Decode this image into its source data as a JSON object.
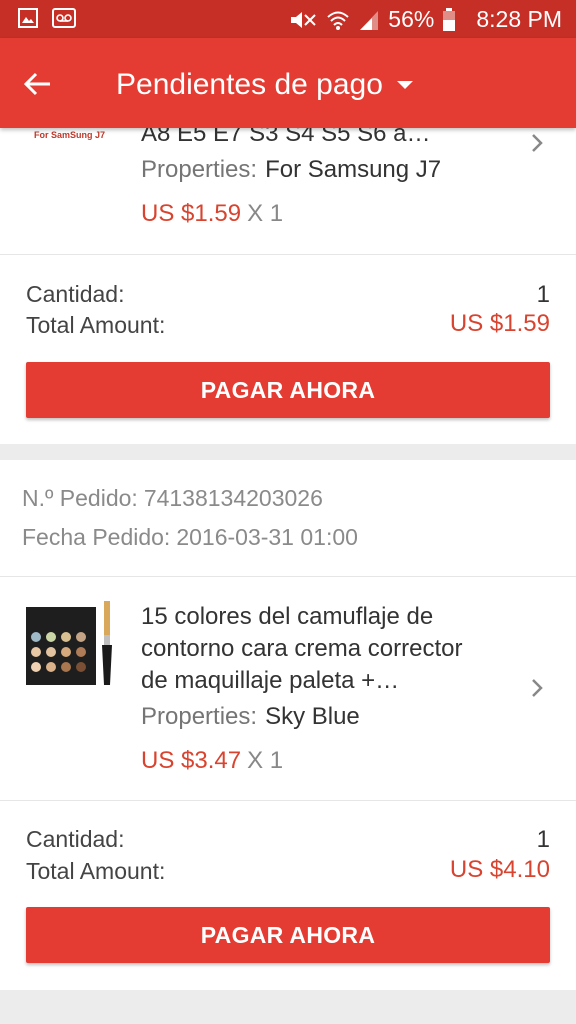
{
  "status_bar": {
    "battery": "56%",
    "time": "8:28 PM",
    "icons": [
      "gallery-icon",
      "voicemail-icon",
      "mute-icon",
      "wifi-icon",
      "signal-icon",
      "battery-icon"
    ]
  },
  "app_bar": {
    "back_icon": "arrow-left-icon",
    "title": "Pendientes de pago",
    "dropdown_icon": "caret-down-icon"
  },
  "orders": [
    {
      "item": {
        "thumb_text": "For SamSung J7",
        "title_line": "A8 E5 E7 S3 S4 S5 S6 a…",
        "properties_label": "Properties:",
        "properties_value": "For Samsung J7",
        "price": "US $1.59",
        "qty": "X 1"
      },
      "summary": {
        "cantidad_label": "Cantidad:",
        "cantidad_value": "1",
        "total_label": "Total Amount:",
        "total_value": "US $1.59"
      },
      "pay_label": "PAGAR AHORA"
    },
    {
      "order_no_label": "N.º Pedido:",
      "order_no": "74138134203026",
      "date_label": "Fecha Pedido:",
      "date": "2016-03-31 01:00",
      "item": {
        "title_lines": [
          "15 colores del camuflaje de",
          "contorno cara crema corrector",
          "de maquillaje paleta +…"
        ],
        "properties_label": "Properties:",
        "properties_value": "Sky Blue",
        "price": "US $3.47",
        "qty": "X 1"
      },
      "summary": {
        "cantidad_label": "Cantidad:",
        "cantidad_value": "1",
        "total_label": "Total Amount:",
        "total_value": "US $4.10"
      },
      "pay_label": "PAGAR AHORA"
    }
  ],
  "colors": {
    "status_bar": "#c62f26",
    "app_bar": "#e43b32",
    "price": "#d8442f",
    "button": "#e43b32"
  }
}
